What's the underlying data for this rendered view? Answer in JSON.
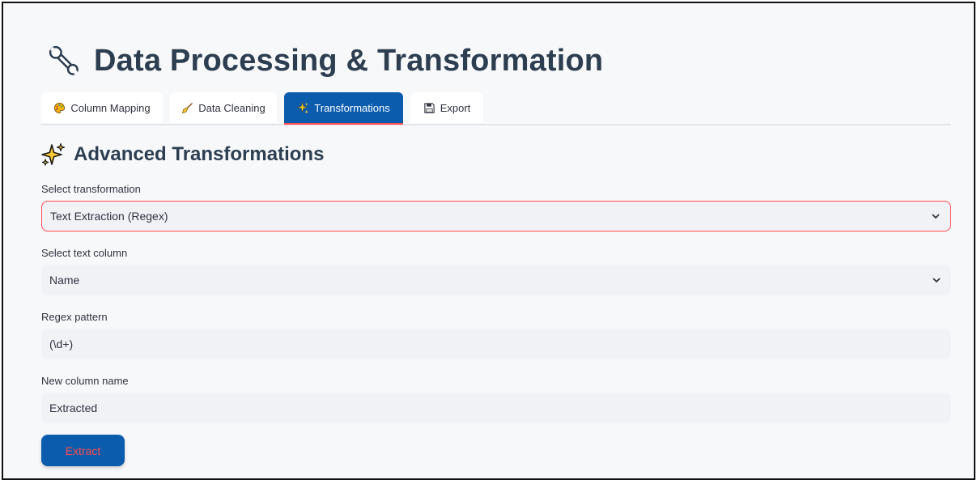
{
  "header": {
    "title": "Data Processing & Transformation",
    "icon": "wrench-icon"
  },
  "tabs": [
    {
      "label": "Column Mapping",
      "icon": "palette-icon",
      "active": false
    },
    {
      "label": "Data Cleaning",
      "icon": "broom-icon",
      "active": false
    },
    {
      "label": "Transformations",
      "icon": "sparkles-icon",
      "active": true
    },
    {
      "label": "Export",
      "icon": "floppy-disk-icon",
      "active": false
    }
  ],
  "section": {
    "title": "Advanced Transformations",
    "icon": "sparkles-icon"
  },
  "form": {
    "transformation": {
      "label": "Select transformation",
      "value": "Text Extraction (Regex)"
    },
    "text_column": {
      "label": "Select text column",
      "value": "Name"
    },
    "regex": {
      "label": "Regex pattern",
      "value": "(\\d+)"
    },
    "new_column": {
      "label": "New column name",
      "value": "Extracted"
    },
    "submit_label": "Extract"
  },
  "colors": {
    "accent": "#0b5cad",
    "focus": "#ff4b4b",
    "title": "#2c3e50",
    "field_bg": "#f0f2f6"
  }
}
